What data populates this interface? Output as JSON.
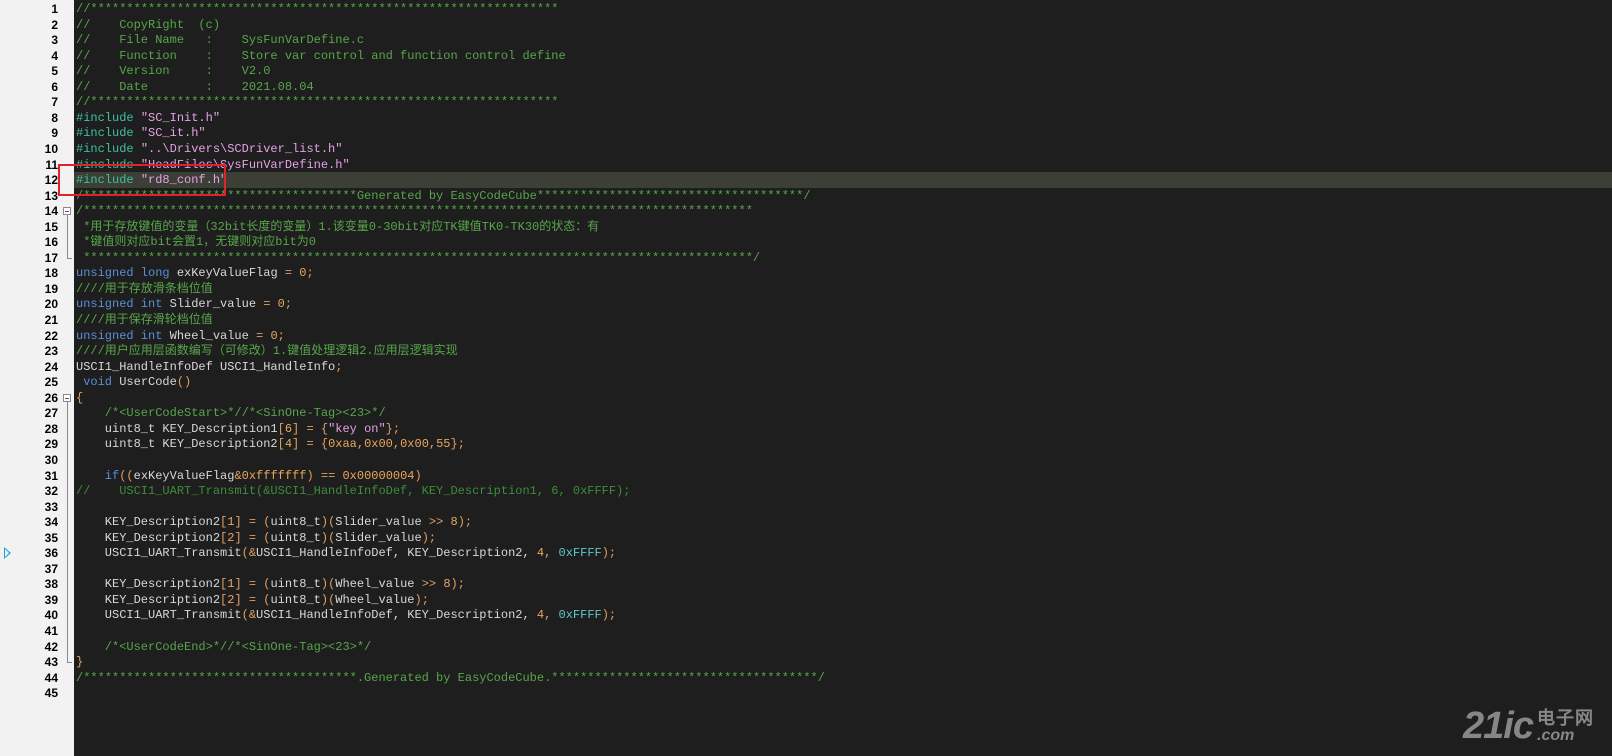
{
  "editor": {
    "current_line": 12,
    "bookmark_line": 36,
    "highlight_box_lines": [
      11,
      12
    ],
    "colors": {
      "background": "#1e1e1e",
      "gutter": "#f2f2f2",
      "comment": "#57a64a",
      "preprocessor": "#3ec0a0",
      "keyword": "#5a8fd8",
      "string": "#e6a2e6",
      "number": "#e8a75e",
      "current_line": "#3b3f35",
      "highlight_box": "#e0222b"
    },
    "fold_markers": [
      {
        "start": 14,
        "end": 17
      },
      {
        "start": 26,
        "end": 43
      }
    ],
    "lines": [
      {
        "n": "1",
        "tokens": [
          {
            "t": "c",
            "v": "//*****************************************************************"
          }
        ]
      },
      {
        "n": "2",
        "tokens": [
          {
            "t": "c",
            "v": "//    CopyRight  (c)"
          }
        ]
      },
      {
        "n": "3",
        "tokens": [
          {
            "t": "c",
            "v": "//    File Name   :    SysFunVarDefine.c"
          }
        ]
      },
      {
        "n": "4",
        "tokens": [
          {
            "t": "c",
            "v": "//    Function    :    Store var control and function control define"
          }
        ]
      },
      {
        "n": "5",
        "tokens": [
          {
            "t": "c",
            "v": "//    Version     :    V2.0"
          }
        ]
      },
      {
        "n": "6",
        "tokens": [
          {
            "t": "c",
            "v": "//    Date        :    2021.08.04"
          }
        ]
      },
      {
        "n": "7",
        "tokens": [
          {
            "t": "c",
            "v": "//*****************************************************************"
          }
        ]
      },
      {
        "n": "8",
        "tokens": [
          {
            "t": "p",
            "v": "#include "
          },
          {
            "t": "s",
            "v": "\"SC_Init.h\""
          }
        ]
      },
      {
        "n": "9",
        "tokens": [
          {
            "t": "p",
            "v": "#include "
          },
          {
            "t": "s",
            "v": "\"SC_it.h\""
          }
        ]
      },
      {
        "n": "10",
        "tokens": [
          {
            "t": "p",
            "v": "#include "
          },
          {
            "t": "s",
            "v": "\"..\\Drivers\\SCDriver_list.h\""
          }
        ]
      },
      {
        "n": "11",
        "tokens": [
          {
            "t": "p",
            "v": "#include "
          },
          {
            "t": "s",
            "v": "\"HeadFiles\\SysFunVarDefine.h\""
          }
        ]
      },
      {
        "n": "12",
        "tokens": [
          {
            "t": "p",
            "v": "#include "
          },
          {
            "t": "s",
            "v": "\"rd8_conf.h\""
          }
        ]
      },
      {
        "n": "13",
        "tokens": [
          {
            "t": "c",
            "v": "/**************************************Generated by EasyCodeCube*************************************/"
          }
        ]
      },
      {
        "n": "14",
        "tokens": [
          {
            "t": "c",
            "v": "/*********************************************************************************************"
          }
        ]
      },
      {
        "n": "15",
        "tokens": [
          {
            "t": "c",
            "v": " *用于存放键值的变量（32bit长度的变量）1.该变量0-30bit对应TK键值TK0-TK30的状态：有"
          }
        ]
      },
      {
        "n": "16",
        "tokens": [
          {
            "t": "c",
            "v": " *键值则对应bit会置1，无键则对应bit为0"
          }
        ]
      },
      {
        "n": "17",
        "tokens": [
          {
            "t": "c",
            "v": " *********************************************************************************************/"
          }
        ]
      },
      {
        "n": "18",
        "tokens": [
          {
            "t": "k",
            "v": "unsigned long "
          },
          {
            "t": "i",
            "v": "exKeyValueFlag "
          },
          {
            "t": "o",
            "v": "= "
          },
          {
            "t": "n",
            "v": "0"
          },
          {
            "t": "o",
            "v": ";"
          }
        ]
      },
      {
        "n": "19",
        "tokens": [
          {
            "t": "c",
            "v": "////用于存放滑条档位值"
          }
        ]
      },
      {
        "n": "20",
        "tokens": [
          {
            "t": "k",
            "v": "unsigned int "
          },
          {
            "t": "i",
            "v": "Slider_value "
          },
          {
            "t": "o",
            "v": "= "
          },
          {
            "t": "n",
            "v": "0"
          },
          {
            "t": "o",
            "v": ";"
          }
        ]
      },
      {
        "n": "21",
        "tokens": [
          {
            "t": "c",
            "v": "////用于保存滑轮档位值"
          }
        ]
      },
      {
        "n": "22",
        "tokens": [
          {
            "t": "k",
            "v": "unsigned int "
          },
          {
            "t": "i",
            "v": "Wheel_value "
          },
          {
            "t": "o",
            "v": "= "
          },
          {
            "t": "n",
            "v": "0"
          },
          {
            "t": "o",
            "v": ";"
          }
        ]
      },
      {
        "n": "23",
        "tokens": [
          {
            "t": "c",
            "v": "////用户应用层函数编写（可修改）1.键值处理逻辑2.应用层逻辑实现"
          }
        ]
      },
      {
        "n": "24",
        "tokens": [
          {
            "t": "i",
            "v": "USCI1_HandleInfoDef USCI1_HandleInfo"
          },
          {
            "t": "o",
            "v": ";"
          }
        ]
      },
      {
        "n": "25",
        "tokens": [
          {
            "t": "k",
            "v": " void "
          },
          {
            "t": "i",
            "v": "UserCode"
          },
          {
            "t": "o",
            "v": "()"
          }
        ]
      },
      {
        "n": "26",
        "tokens": [
          {
            "t": "o",
            "v": "{"
          }
        ]
      },
      {
        "n": "27",
        "tokens": [
          {
            "t": "c",
            "v": "    /*<UserCodeStart>*//*<SinOne-Tag><23>*/"
          }
        ]
      },
      {
        "n": "28",
        "tokens": [
          {
            "t": "i",
            "v": "    uint8_t KEY_Description1"
          },
          {
            "t": "o",
            "v": "["
          },
          {
            "t": "n",
            "v": "6"
          },
          {
            "t": "o",
            "v": "] = {"
          },
          {
            "t": "s",
            "v": "\"key on\""
          },
          {
            "t": "o",
            "v": "};"
          }
        ]
      },
      {
        "n": "29",
        "tokens": [
          {
            "t": "i",
            "v": "    uint8_t KEY_Description2"
          },
          {
            "t": "o",
            "v": "["
          },
          {
            "t": "n",
            "v": "4"
          },
          {
            "t": "o",
            "v": "] = {"
          },
          {
            "t": "n",
            "v": "0xaa"
          },
          {
            "t": "o",
            "v": ","
          },
          {
            "t": "n",
            "v": "0x00"
          },
          {
            "t": "o",
            "v": ","
          },
          {
            "t": "n",
            "v": "0x00"
          },
          {
            "t": "o",
            "v": ","
          },
          {
            "t": "n",
            "v": "55"
          },
          {
            "t": "o",
            "v": "};"
          }
        ]
      },
      {
        "n": "30",
        "tokens": []
      },
      {
        "n": "31",
        "tokens": [
          {
            "t": "k",
            "v": "    if"
          },
          {
            "t": "o",
            "v": "(("
          },
          {
            "t": "i",
            "v": "exKeyValueFlag"
          },
          {
            "t": "o",
            "v": "&"
          },
          {
            "t": "n",
            "v": "0xfffffff"
          },
          {
            "t": "o",
            "v": ") == "
          },
          {
            "t": "n",
            "v": "0x00000004"
          },
          {
            "t": "o",
            "v": ")"
          }
        ]
      },
      {
        "n": "32",
        "tokens": [
          {
            "t": "d",
            "v": "//    USCI1_UART_Transmit(&USCI1_HandleInfoDef, KEY_Description1, 6, 0xFFFF);"
          }
        ]
      },
      {
        "n": "33",
        "tokens": []
      },
      {
        "n": "34",
        "tokens": [
          {
            "t": "i",
            "v": "    KEY_Description2"
          },
          {
            "t": "o",
            "v": "["
          },
          {
            "t": "n",
            "v": "1"
          },
          {
            "t": "o",
            "v": "] = ("
          },
          {
            "t": "i",
            "v": "uint8_t"
          },
          {
            "t": "o",
            "v": ")("
          },
          {
            "t": "i",
            "v": "Slider_value "
          },
          {
            "t": "o",
            "v": ">> "
          },
          {
            "t": "n",
            "v": "8"
          },
          {
            "t": "o",
            "v": ");"
          }
        ]
      },
      {
        "n": "35",
        "tokens": [
          {
            "t": "i",
            "v": "    KEY_Description2"
          },
          {
            "t": "o",
            "v": "["
          },
          {
            "t": "n",
            "v": "2"
          },
          {
            "t": "o",
            "v": "] = ("
          },
          {
            "t": "i",
            "v": "uint8_t"
          },
          {
            "t": "o",
            "v": ")("
          },
          {
            "t": "i",
            "v": "Slider_value"
          },
          {
            "t": "o",
            "v": ");"
          }
        ]
      },
      {
        "n": "36",
        "tokens": [
          {
            "t": "i",
            "v": "    USCI1_UART_Transmit"
          },
          {
            "t": "o",
            "v": "(&"
          },
          {
            "t": "i",
            "v": "USCI1_HandleInfoDef, KEY_Description2, "
          },
          {
            "t": "n",
            "v": "4"
          },
          {
            "t": "o",
            "v": ", "
          },
          {
            "t": "h",
            "v": "0xFFFF"
          },
          {
            "t": "o",
            "v": ");"
          }
        ]
      },
      {
        "n": "37",
        "tokens": []
      },
      {
        "n": "38",
        "tokens": [
          {
            "t": "i",
            "v": "    KEY_Description2"
          },
          {
            "t": "o",
            "v": "["
          },
          {
            "t": "n",
            "v": "1"
          },
          {
            "t": "o",
            "v": "] = ("
          },
          {
            "t": "i",
            "v": "uint8_t"
          },
          {
            "t": "o",
            "v": ")("
          },
          {
            "t": "i",
            "v": "Wheel_value "
          },
          {
            "t": "o",
            "v": ">> "
          },
          {
            "t": "n",
            "v": "8"
          },
          {
            "t": "o",
            "v": ");"
          }
        ]
      },
      {
        "n": "39",
        "tokens": [
          {
            "t": "i",
            "v": "    KEY_Description2"
          },
          {
            "t": "o",
            "v": "["
          },
          {
            "t": "n",
            "v": "2"
          },
          {
            "t": "o",
            "v": "] = ("
          },
          {
            "t": "i",
            "v": "uint8_t"
          },
          {
            "t": "o",
            "v": ")("
          },
          {
            "t": "i",
            "v": "Wheel_value"
          },
          {
            "t": "o",
            "v": ");"
          }
        ]
      },
      {
        "n": "40",
        "tokens": [
          {
            "t": "i",
            "v": "    USCI1_UART_Transmit"
          },
          {
            "t": "o",
            "v": "(&"
          },
          {
            "t": "i",
            "v": "USCI1_HandleInfoDef, KEY_Description2, "
          },
          {
            "t": "n",
            "v": "4"
          },
          {
            "t": "o",
            "v": ", "
          },
          {
            "t": "h",
            "v": "0xFFFF"
          },
          {
            "t": "o",
            "v": ");"
          }
        ]
      },
      {
        "n": "41",
        "tokens": []
      },
      {
        "n": "42",
        "tokens": [
          {
            "t": "c",
            "v": "    /*<UserCodeEnd>*//*<SinOne-Tag><23>*/"
          }
        ]
      },
      {
        "n": "43",
        "tokens": [
          {
            "t": "o",
            "v": "}"
          }
        ]
      },
      {
        "n": "44",
        "tokens": [
          {
            "t": "c",
            "v": "/**************************************.Generated by EasyCodeCube.*************************************/"
          }
        ]
      },
      {
        "n": "45",
        "tokens": []
      }
    ]
  },
  "watermark": {
    "brand": "21ic",
    "cn_text": "电子网",
    "domain": ".com"
  }
}
